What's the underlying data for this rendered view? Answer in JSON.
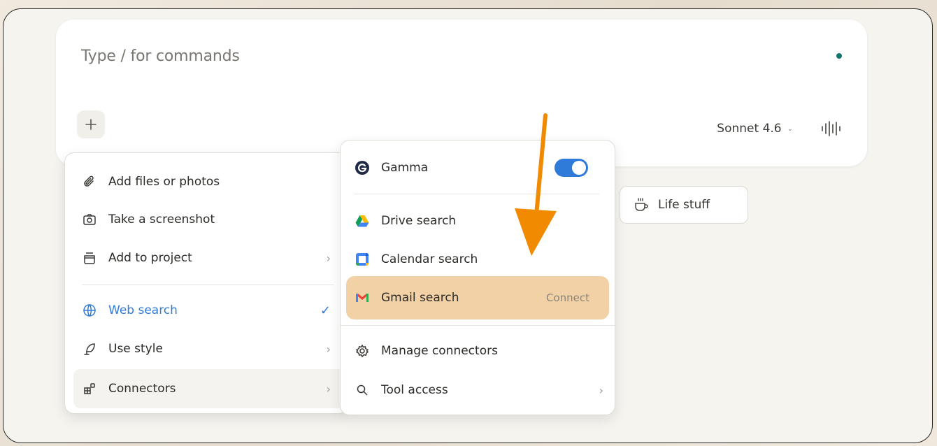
{
  "composer": {
    "placeholder": "Type / for commands",
    "model": "Sonnet 4.6"
  },
  "attach_menu": {
    "items": [
      {
        "label": "Add files or photos",
        "icon": "paperclip-icon"
      },
      {
        "label": "Take a screenshot",
        "icon": "camera-icon"
      },
      {
        "label": "Add to project",
        "icon": "project-box-icon",
        "submenu": true
      },
      {
        "label": "Web search",
        "icon": "globe-icon",
        "checked": true,
        "active_color": "#2f7bd9"
      },
      {
        "label": "Use style",
        "icon": "feather-icon",
        "submenu": true
      },
      {
        "label": "Connectors",
        "icon": "connectors-icon",
        "submenu": true
      }
    ]
  },
  "connectors_menu": {
    "gamma": {
      "label": "Gamma",
      "toggle": "on"
    },
    "items": [
      {
        "label": "Drive search",
        "icon": "google-drive-icon"
      },
      {
        "label": "Calendar search",
        "icon": "google-calendar-icon"
      },
      {
        "label": "Gmail search",
        "icon": "gmail-icon",
        "action": "Connect",
        "highlighted": true,
        "highlight_color": "#f2d1a6"
      },
      {
        "label": "Manage connectors",
        "icon": "gear-icon"
      },
      {
        "label": "Tool access",
        "icon": "search-icon",
        "submenu": true
      }
    ]
  },
  "chip": {
    "label": "Life stuff",
    "icon": "coffee-cup-icon"
  },
  "annotation": {
    "arrow_color": "#f28a00"
  }
}
